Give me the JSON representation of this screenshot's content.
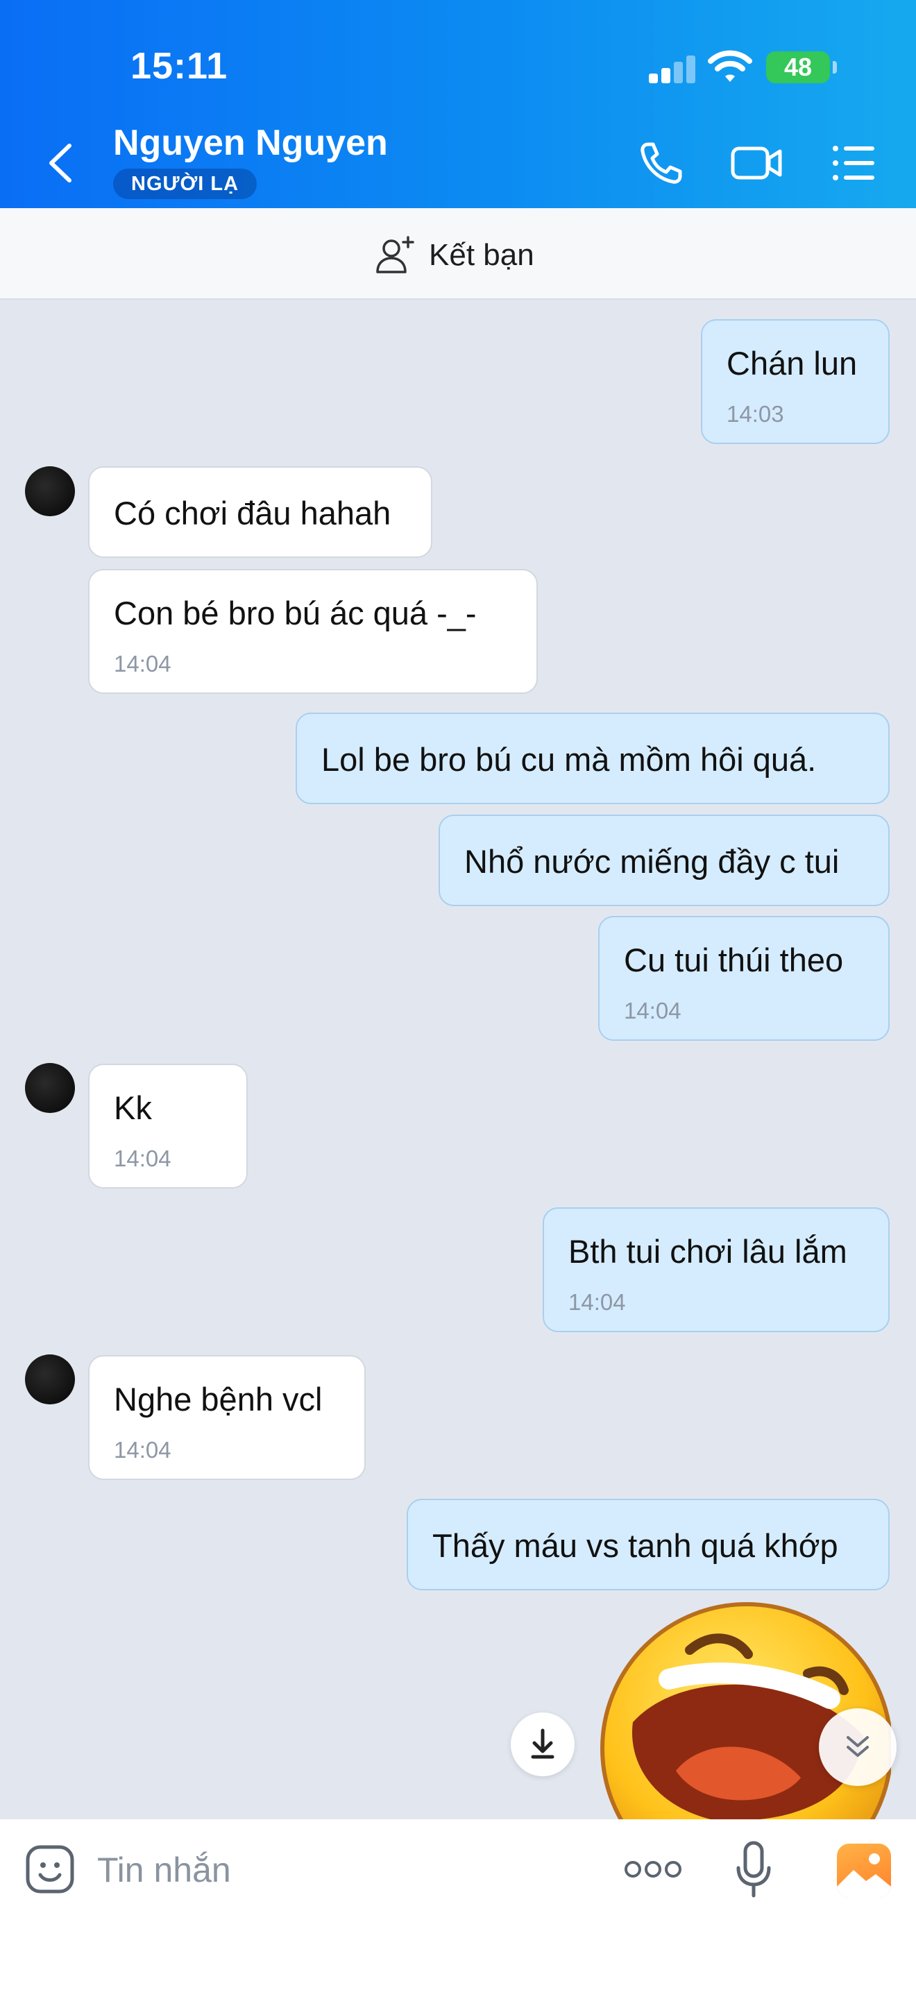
{
  "status_bar": {
    "time": "15:11",
    "battery": "48"
  },
  "header": {
    "contact_name": "Nguyen Nguyen",
    "badge": "NGƯỜI LẠ",
    "icons": [
      "back-icon",
      "phone-icon",
      "video-call-icon",
      "menu-list-icon"
    ]
  },
  "friend_bar": {
    "label": "Kết bạn",
    "icon": "add-friend-icon"
  },
  "messages": [
    {
      "direction": "out",
      "text": "Chán lun",
      "time": "14:03"
    },
    {
      "direction": "in",
      "text": "Có chơi đâu hahah",
      "time": ""
    },
    {
      "direction": "in",
      "text": "Con bé bro bú ác quá -_-",
      "time": "14:04"
    },
    {
      "direction": "out",
      "text": "Lol  be bro bú cu mà mồm hôi quá.",
      "time": ""
    },
    {
      "direction": "out",
      "text": "Nhổ nước miếng đầy c tui",
      "time": ""
    },
    {
      "direction": "out",
      "text": "Cu tui thúi theo",
      "time": "14:04"
    },
    {
      "direction": "in",
      "text": "Kk",
      "time": "14:04"
    },
    {
      "direction": "out",
      "text": "Bth tui chơi lâu lắm",
      "time": "14:04"
    },
    {
      "direction": "in",
      "text": "Nghe bệnh vcl",
      "time": "14:04"
    },
    {
      "direction": "out",
      "text": "Thấy máu vs tanh quá khớp",
      "time": ""
    }
  ],
  "sticker": "laughing-emoji-sticker",
  "composer": {
    "placeholder": "Tin nhắn",
    "icons": [
      "emoji-icon",
      "more-options-icon",
      "microphone-icon",
      "image-gallery-icon"
    ]
  },
  "colors": {
    "header_start": "#0a6ef5",
    "header_end": "#16a9ef",
    "outgoing_bubble": "#d5ecfe",
    "incoming_bubble": "#ffffff",
    "chat_background": "#e2e7ef"
  }
}
